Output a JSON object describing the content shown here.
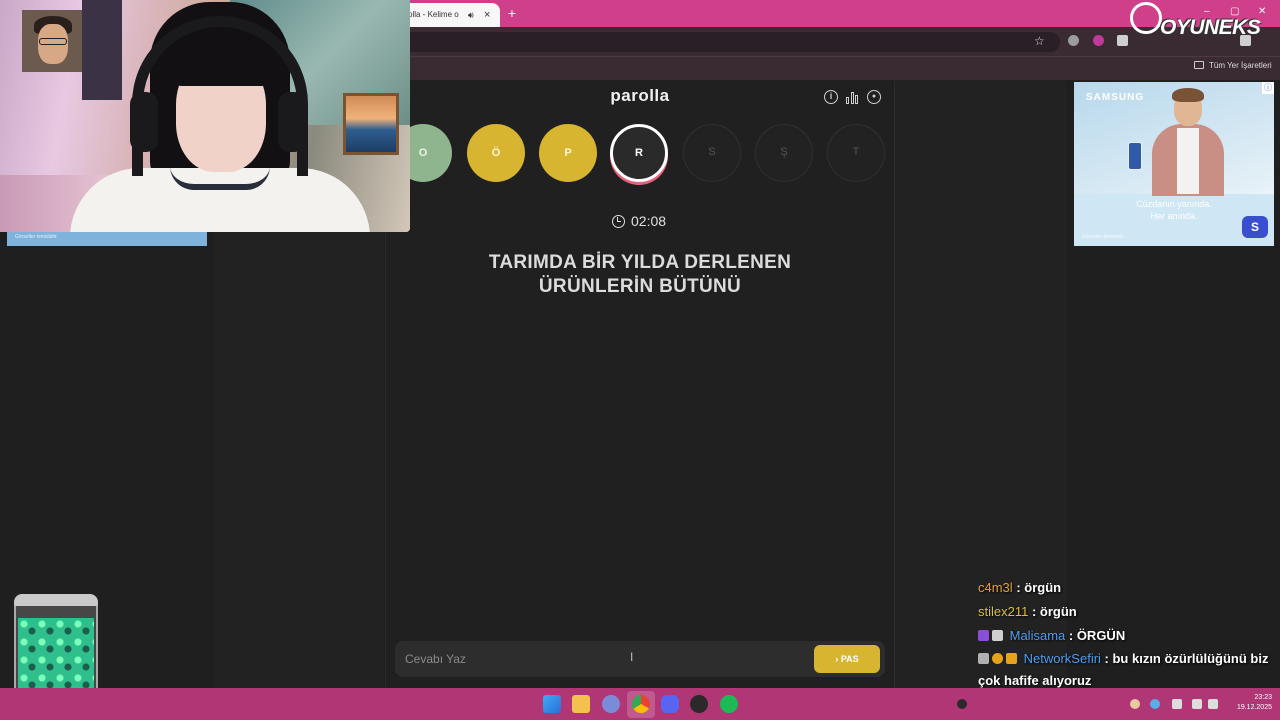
{
  "browser": {
    "tab_title": "olla - Kelime o",
    "tab_audio_icon": "speaker-icon",
    "tab_close_icon": "close-icon",
    "new_tab_label": "+",
    "bookmarks_folder_label": "Tüm Yer İşaretleri",
    "window_min": "–",
    "window_max": "▢",
    "window_close": "✕",
    "star_icon": "☆"
  },
  "game": {
    "brand": "parolla",
    "header_icons": [
      "info-icon",
      "stats-icon",
      "user-icon"
    ],
    "info_glyph": "i",
    "user_glyph": "●",
    "letters": [
      {
        "letter": "O",
        "state": "correct"
      },
      {
        "letter": "Ö",
        "state": "passed"
      },
      {
        "letter": "P",
        "state": "passed"
      },
      {
        "letter": "R",
        "state": "active"
      },
      {
        "letter": "S",
        "state": "idle"
      },
      {
        "letter": "Ş",
        "state": "idle"
      },
      {
        "letter": "T",
        "state": "idle"
      }
    ],
    "timer": "02:08",
    "question_line1": "TARIMDA BİR YILDA DERLENEN",
    "question_line2": "ÜRÜNLERİN BÜTÜNÜ",
    "answer_placeholder": "Cevabı Yaz",
    "pass_button": "›  PAS",
    "colors": {
      "correct": "#8fb58f",
      "passed": "#d8b531",
      "active_ring": "#e8607a"
    }
  },
  "ad": {
    "brand": "SAMSUNG",
    "line1": "Cüzdanın yanında.",
    "line2": "Her anında.",
    "note": "Görseller temsilidir.",
    "logo": "S",
    "close_glyph": "ⓘ"
  },
  "overlay": {
    "logo_text": "OYUNEKS"
  },
  "chat": [
    {
      "user": "c4m3l",
      "color": "#e0a040",
      "badges": [],
      "text": ": örgün"
    },
    {
      "user": "stilex211",
      "color": "#d8c040",
      "badges": [],
      "text": ": örgün"
    },
    {
      "user": "Malisama",
      "color": "#4f9cf0",
      "badges": [
        "#8a4fd8",
        "#cfcfcf"
      ],
      "text": ": ÖRGÜN"
    },
    {
      "user": "NetworkSefiri",
      "color": "#4f9cf0",
      "badges": [
        "#b0b0b0",
        "#e6a21a",
        "#e6a21a"
      ],
      "text": ": bu kızın özürlülüğünü biz çok hafife alıyoruz"
    }
  ],
  "taskbar": {
    "icons": [
      "windows-icon",
      "explorer-icon",
      "network-icon",
      "chrome-icon",
      "discord-icon",
      "obs-icon",
      "spotify-icon"
    ],
    "time": "23:23",
    "date": "19.12.2025"
  }
}
